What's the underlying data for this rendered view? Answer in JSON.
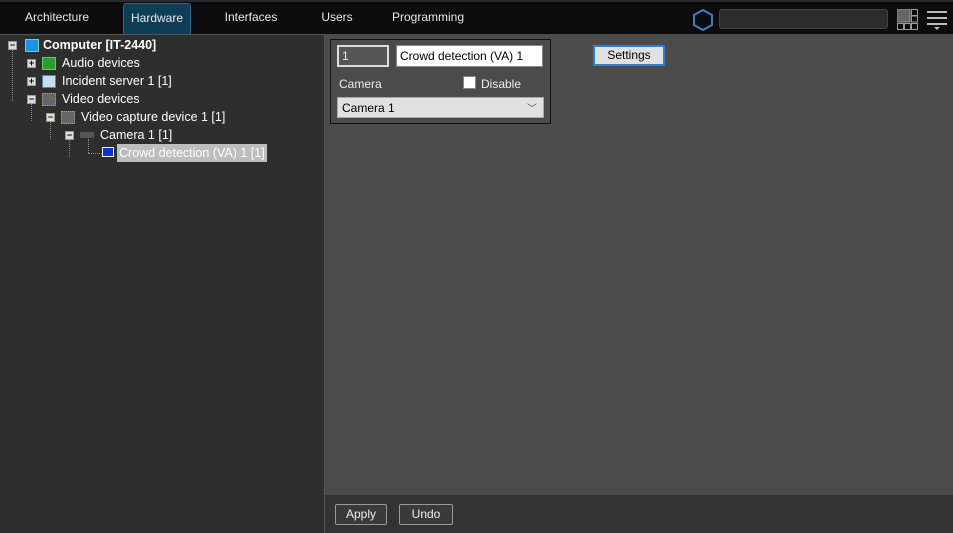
{
  "tabs": [
    {
      "label": "Architecture"
    },
    {
      "label": "Hardware"
    },
    {
      "label": "Interfaces"
    },
    {
      "label": "Users"
    },
    {
      "label": "Programming"
    }
  ],
  "active_tab": "Hardware",
  "search": {
    "value": ""
  },
  "tree": {
    "computer": "Computer [IT-2440]",
    "audio": "Audio devices",
    "incident": "Incident server 1 [1]",
    "video": "Video devices",
    "capture": "Video capture device 1 [1]",
    "camera": "Camera 1 [1]",
    "crowd": "Crowd detection (VA) 1 [1]"
  },
  "form": {
    "id_value": "1",
    "name_value": "Crowd detection (VA) 1",
    "camera_label": "Camera",
    "disable_label": "Disable",
    "disable_checked": false,
    "camera_select": "Camera 1",
    "settings_label": "Settings"
  },
  "footer": {
    "apply": "Apply",
    "undo": "Undo"
  }
}
